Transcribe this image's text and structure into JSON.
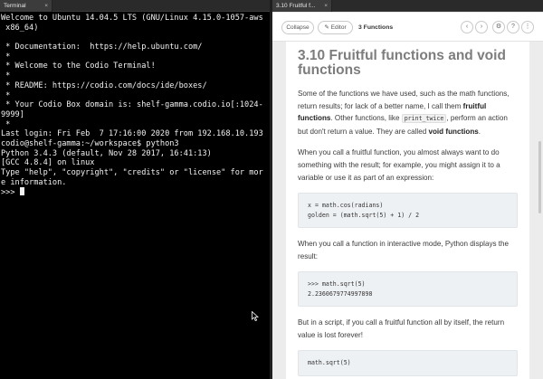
{
  "terminal": {
    "tab_label": "Terminal",
    "tab_close": "×",
    "lines": [
      "Welcome to Ubuntu 14.04.5 LTS (GNU/Linux 4.15.0-1057-aws",
      " x86_64)",
      "",
      " * Documentation:  https://help.ubuntu.com/",
      " *",
      " * Welcome to the Codio Terminal!",
      " *",
      " * README: https://codio.com/docs/ide/boxes/",
      " *",
      " * Your Codio Box domain is: shelf-gamma.codio.io[:1024-",
      "9999]",
      " *",
      "Last login: Fri Feb  7 17:16:00 2020 from 192.168.10.193",
      "codio@shelf-gamma:~/workspace$ python3",
      "Python 3.4.3 (default, Nov 28 2017, 16:41:13)",
      "[GCC 4.8.4] on linux",
      "Type \"help\", \"copyright\", \"credits\" or \"license\" for mor",
      "e information."
    ],
    "prompt": ">>> "
  },
  "guide": {
    "tab_label": "3.10 Fruitful f...",
    "tab_close": "×",
    "toolbar": {
      "collapse_label": "Collapse",
      "editor_label": "✎ Editor",
      "section_title": "3 Functions",
      "prev_icon": "‹",
      "next_icon": "›",
      "settings_icon": "⚙",
      "help_icon": "?",
      "more_icon": "⋮"
    },
    "title": "3.10 Fruitful functions and void functions",
    "p1_a": "Some of the functions we have used, such as the math functions, return results; for lack of a better name, I call them ",
    "p1_b": "fruitful functions",
    "p1_c": ". Other functions, like ",
    "p1_code": "print_twice",
    "p1_d": ", perform an action but don't return a value. They are called ",
    "p1_e": "void functions",
    "p1_f": ".",
    "p2": "When you call a fruitful function, you almost always want to do something with the result; for example, you might assign it to a variable or use it as part of an expression:",
    "code1": "x = math.cos(radians)\ngolden = (math.sqrt(5) + 1) / 2",
    "p3": "When you call a function in interactive mode, Python displays the result:",
    "code2": ">>> math.sqrt(5)\n2.2360679774997898",
    "p4": "But in a script, if you call a fruitful function all by itself, the return value is lost forever!",
    "code3": "math.sqrt(5)"
  }
}
